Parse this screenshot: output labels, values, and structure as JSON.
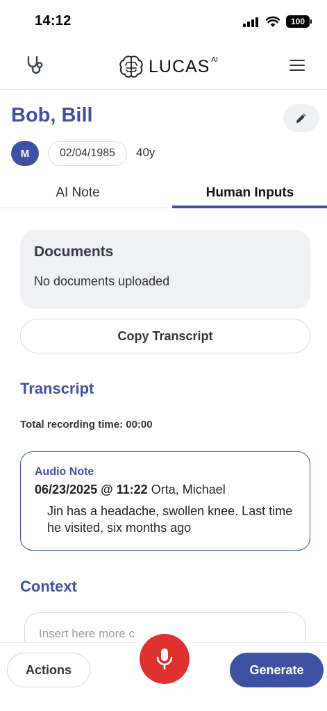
{
  "status_bar": {
    "time": "14:12",
    "battery": "100"
  },
  "header": {
    "logo_text": "LUCAS",
    "logo_superscript": "AI"
  },
  "patient": {
    "name": "Bob, Bill",
    "gender": "M",
    "dob": "02/04/1985",
    "age": "40y"
  },
  "tabs": [
    {
      "label": "AI Note",
      "active": false
    },
    {
      "label": "Human Inputs",
      "active": true
    }
  ],
  "documents": {
    "title": "Documents",
    "empty_text": "No documents uploaded"
  },
  "copy_transcript": {
    "label": "Copy Transcript"
  },
  "transcript": {
    "title": "Transcript",
    "recording_time": "Total recording time: 00:00",
    "audio_note": {
      "label": "Audio Note",
      "datetime": "06/23/2025 @ 11:22",
      "author": "Orta, Michael",
      "text": "Jin has a headache, swollen knee. Last time he visited, six months ago"
    }
  },
  "context": {
    "title": "Context",
    "placeholder": "Insert here more c"
  },
  "bottom_bar": {
    "actions_label": "Actions",
    "generate_label": "Generate"
  },
  "colors": {
    "accent": "#3f51a3",
    "record": "#e03131",
    "card_bg": "#eff1f4"
  },
  "icons": [
    "stethoscope-icon",
    "brain-icon",
    "menu-icon",
    "pencil-icon",
    "microphone-icon",
    "signal-icon",
    "wifi-icon",
    "battery-icon"
  ]
}
